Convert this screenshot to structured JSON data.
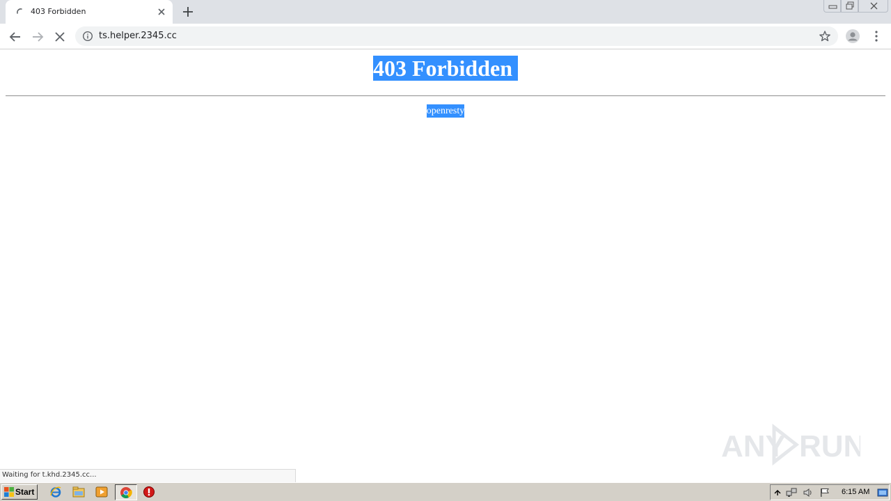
{
  "browser": {
    "tab": {
      "title": "403 Forbidden"
    },
    "address_bar": {
      "url": "ts.helper.2345.cc"
    },
    "status_bar": {
      "text": "Waiting for t.khd.2345.cc..."
    }
  },
  "page": {
    "heading": "403 Forbidden",
    "server": "openresty"
  },
  "watermark": {
    "text": "ANY RUN"
  },
  "taskbar": {
    "start_label": "Start",
    "clock": "6:15 AM",
    "quick_launch": [
      "internet-explorer-icon",
      "file-explorer-icon",
      "media-player-icon",
      "chrome-icon",
      "stop-sign-icon"
    ]
  },
  "colors": {
    "selection": "#3390ff",
    "tabstrip": "#dee1e6",
    "omnibox": "#f1f3f4",
    "taskbar": "#d4d0c8"
  }
}
